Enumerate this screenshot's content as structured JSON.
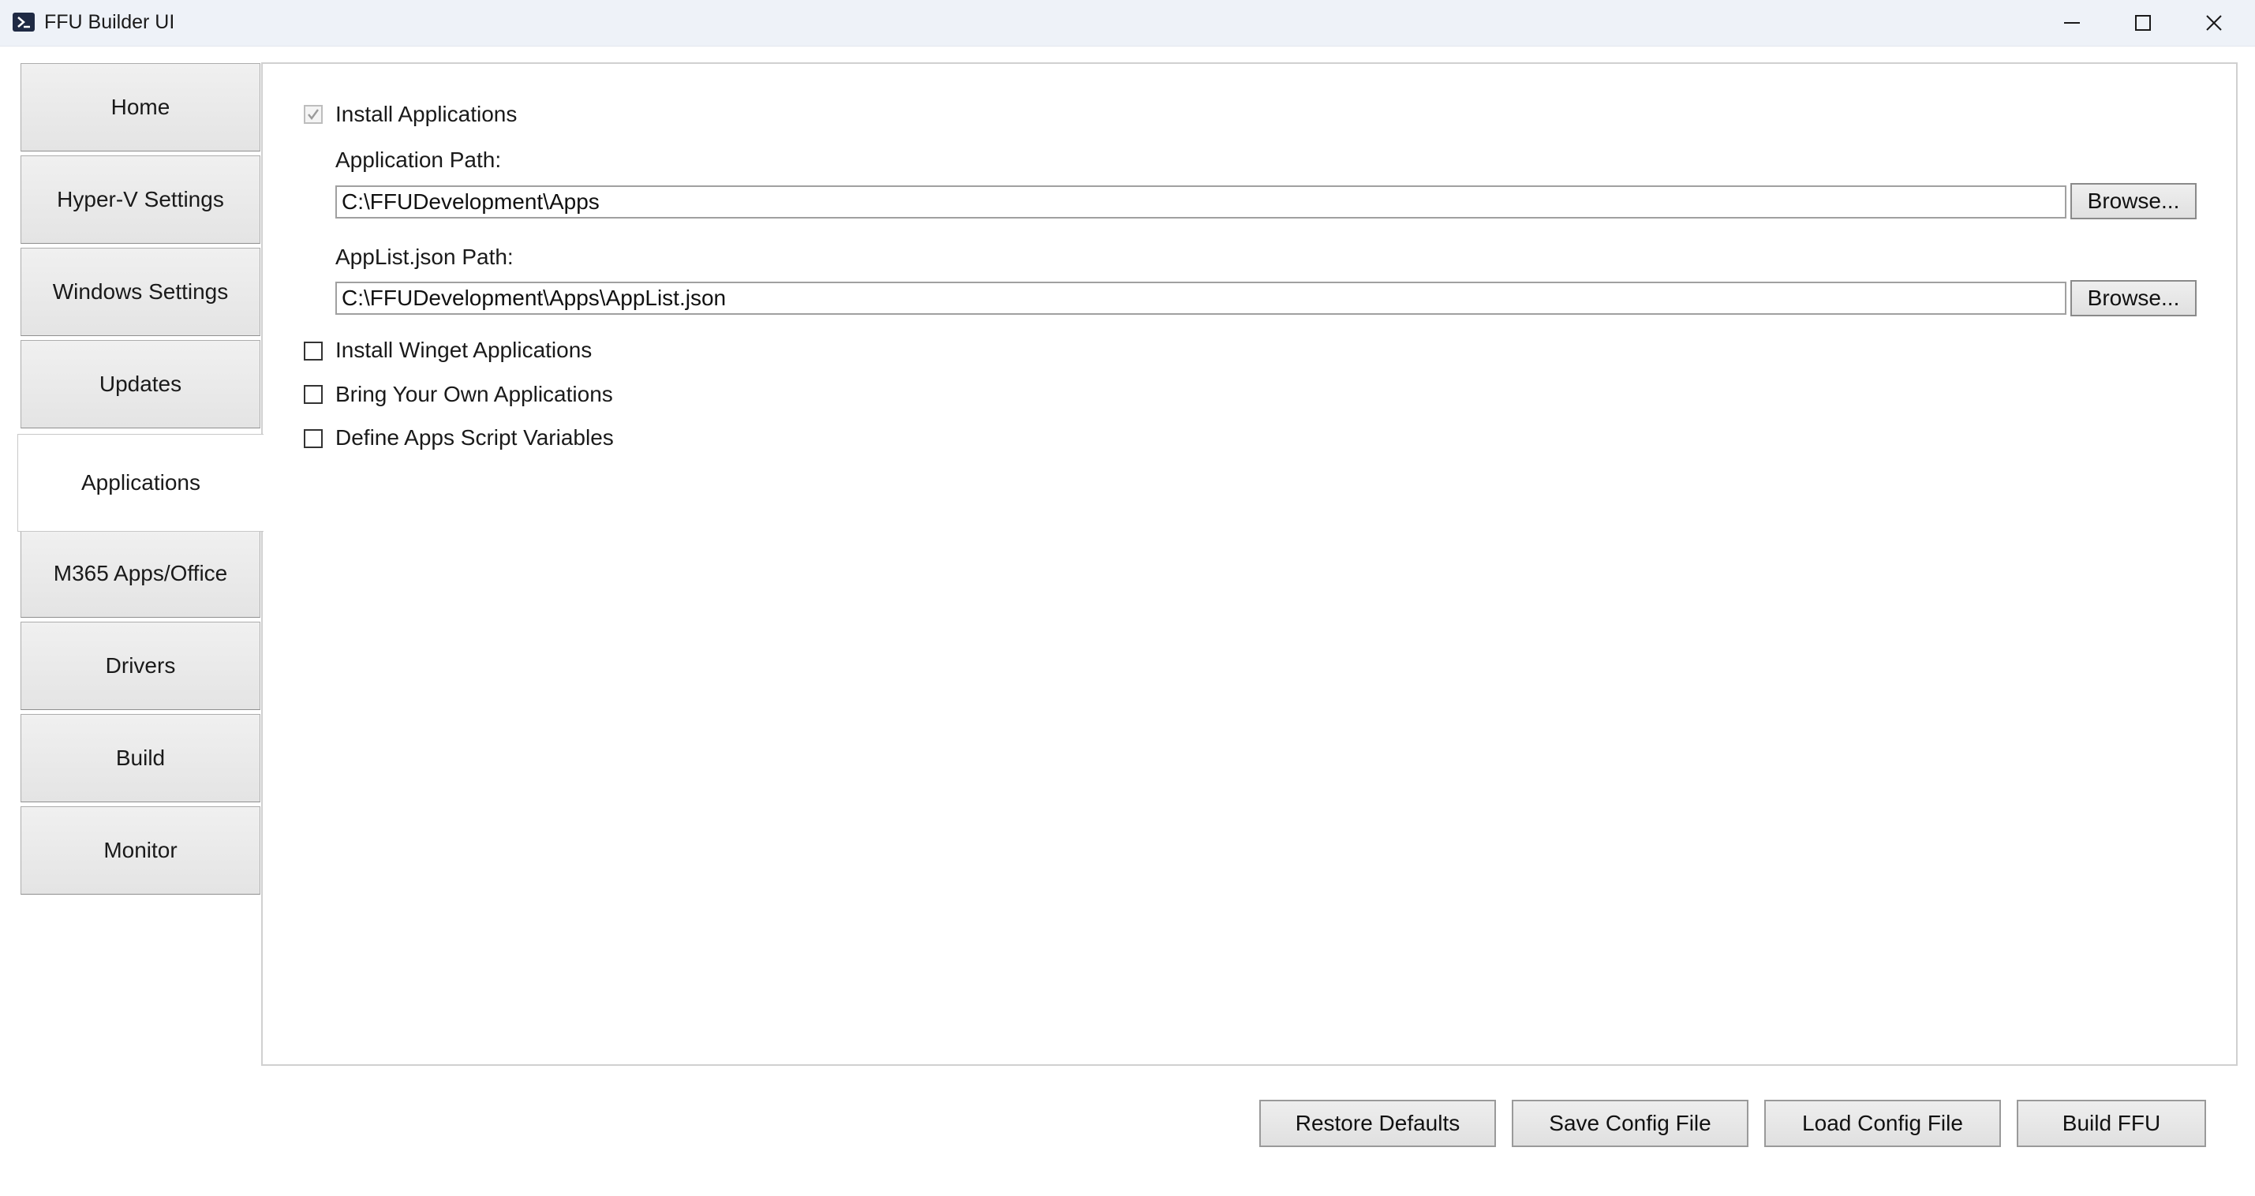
{
  "window": {
    "title": "FFU Builder UI",
    "icon": "powershell-icon",
    "controls": [
      "minimize-icon",
      "maximize-icon",
      "close-icon"
    ]
  },
  "sidebar": {
    "tabs": [
      {
        "label": "Home",
        "active": false
      },
      {
        "label": "Hyper-V Settings",
        "active": false
      },
      {
        "label": "Windows Settings",
        "active": false
      },
      {
        "label": "Updates",
        "active": false
      },
      {
        "label": "Applications",
        "active": true
      },
      {
        "label": "M365 Apps/Office",
        "active": false
      },
      {
        "label": "Drivers",
        "active": false
      },
      {
        "label": "Build",
        "active": false
      },
      {
        "label": "Monitor",
        "active": false
      }
    ]
  },
  "applications": {
    "install_applications": {
      "label": "Install Applications",
      "checked": true,
      "enabled": false
    },
    "application_path": {
      "label": "Application Path:",
      "value": "C:\\FFUDevelopment\\Apps",
      "browse_label": "Browse..."
    },
    "applist_path": {
      "label": "AppList.json Path:",
      "value": "C:\\FFUDevelopment\\Apps\\AppList.json",
      "browse_label": "Browse..."
    },
    "install_winget": {
      "label": "Install Winget Applications",
      "checked": false
    },
    "bring_your_own": {
      "label": "Bring Your Own Applications",
      "checked": false
    },
    "define_script_vars": {
      "label": "Define Apps Script Variables",
      "checked": false
    }
  },
  "footer": {
    "restore_defaults": "Restore Defaults",
    "save_config": "Save Config File",
    "load_config": "Load Config File",
    "build_ffu": "Build FFU"
  },
  "colors": {
    "titlebar_bg": "#eef2f8",
    "tab_bg": "#e8e8e8",
    "active_tab_bg": "#ffffff",
    "border": "#adadad"
  }
}
